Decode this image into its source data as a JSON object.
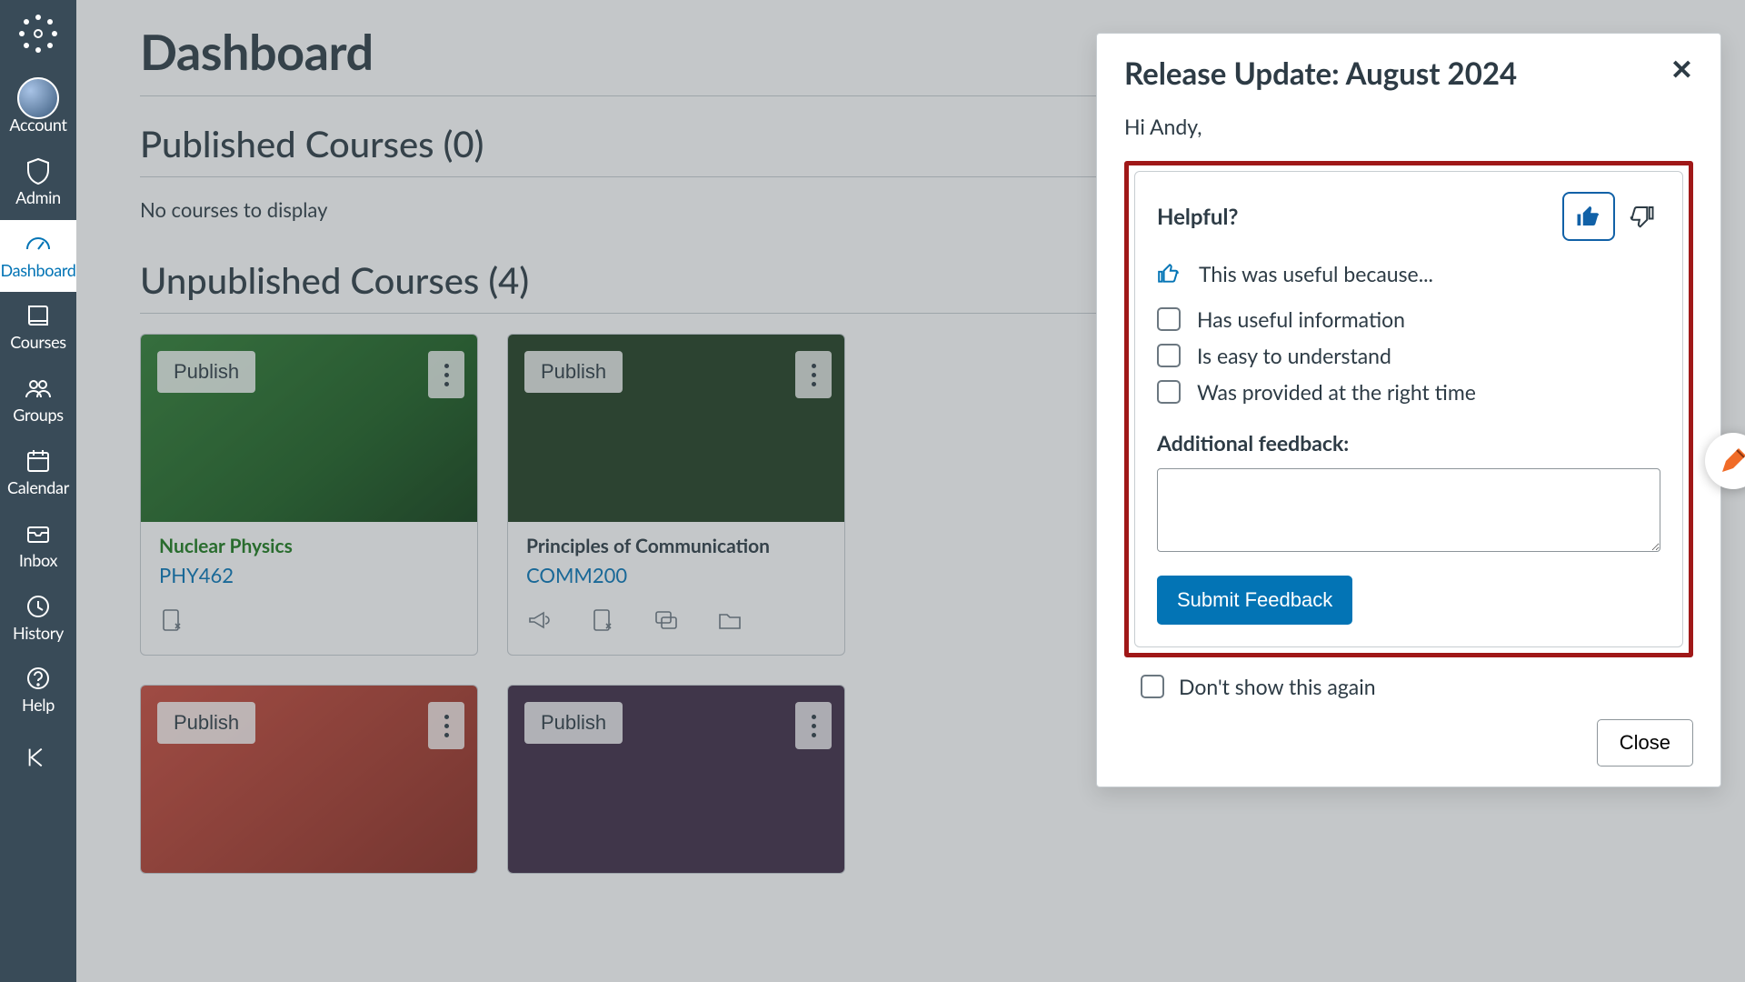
{
  "sidebar": {
    "items": [
      {
        "label": "Account"
      },
      {
        "label": "Admin"
      },
      {
        "label": "Dashboard"
      },
      {
        "label": "Courses"
      },
      {
        "label": "Groups"
      },
      {
        "label": "Calendar"
      },
      {
        "label": "Inbox"
      },
      {
        "label": "History"
      },
      {
        "label": "Help"
      }
    ]
  },
  "page": {
    "title": "Dashboard",
    "published_heading": "Published Courses (0)",
    "empty_text": "No courses to display",
    "unpublished_heading": "Unpublished Courses (4)"
  },
  "cards": [
    {
      "publish": "Publish",
      "name": "Nuclear Physics",
      "code": "PHY462",
      "hero": "green",
      "name_color": "green",
      "footer_icons": [
        "assignments"
      ]
    },
    {
      "publish": "Publish",
      "name": "Principles of Communication",
      "code": "COMM200",
      "hero": "darkgreen",
      "name_color": "dark",
      "footer_icons": [
        "announcements",
        "assignments",
        "discussions",
        "files"
      ]
    },
    {
      "publish": "Publish",
      "hero": "red"
    },
    {
      "publish": "Publish",
      "hero": "purple"
    }
  ],
  "release": {
    "title": "Release Update: August 2024",
    "greeting": "Hi Andy,",
    "feedback": {
      "question": "Helpful?",
      "reason_prompt": "This was useful because...",
      "options": [
        "Has useful information",
        "Is easy to understand",
        "Was provided at the right time"
      ],
      "additional_label": "Additional feedback:",
      "submit_label": "Submit Feedback"
    },
    "dont_show": "Don't show this again",
    "close_label": "Close"
  }
}
